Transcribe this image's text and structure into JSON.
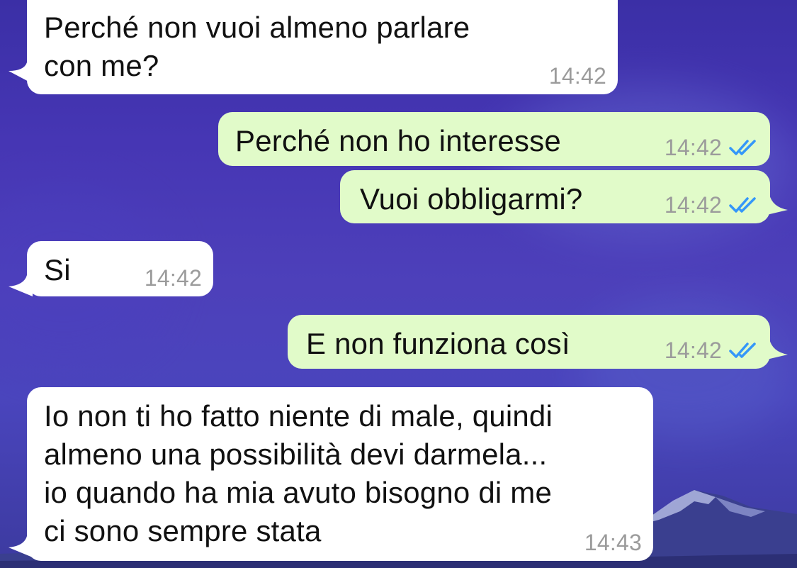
{
  "messages": [
    {
      "direction": "incoming",
      "text_line1": "Perché non vuoi almeno parlare",
      "text_line2": "con me?",
      "time": "14:42"
    },
    {
      "direction": "outgoing",
      "text": "Perché non ho interesse",
      "time": "14:42",
      "status": "read"
    },
    {
      "direction": "outgoing",
      "text": "Vuoi obbligarmi?",
      "time": "14:42",
      "status": "read"
    },
    {
      "direction": "incoming",
      "text": "Si",
      "time": "14:42"
    },
    {
      "direction": "outgoing",
      "text": "E non funziona così",
      "time": "14:42",
      "status": "read"
    },
    {
      "direction": "incoming",
      "text_line1": "Io non ti ho fatto niente di male, quindi",
      "text_line2": "almeno una possibilità devi darmela...",
      "text_line3": "io quando ha mia avuto bisogno di me",
      "text_line4": "ci sono sempre stata",
      "time": "14:43"
    }
  ],
  "colors": {
    "incoming_bubble": "#ffffff",
    "outgoing_bubble": "#e1fbc9",
    "timestamp": "#9b9b9b",
    "read_ticks": "#3497f9",
    "background": "#4a3db8"
  },
  "icons": {
    "read_receipt": "double-check-icon"
  }
}
